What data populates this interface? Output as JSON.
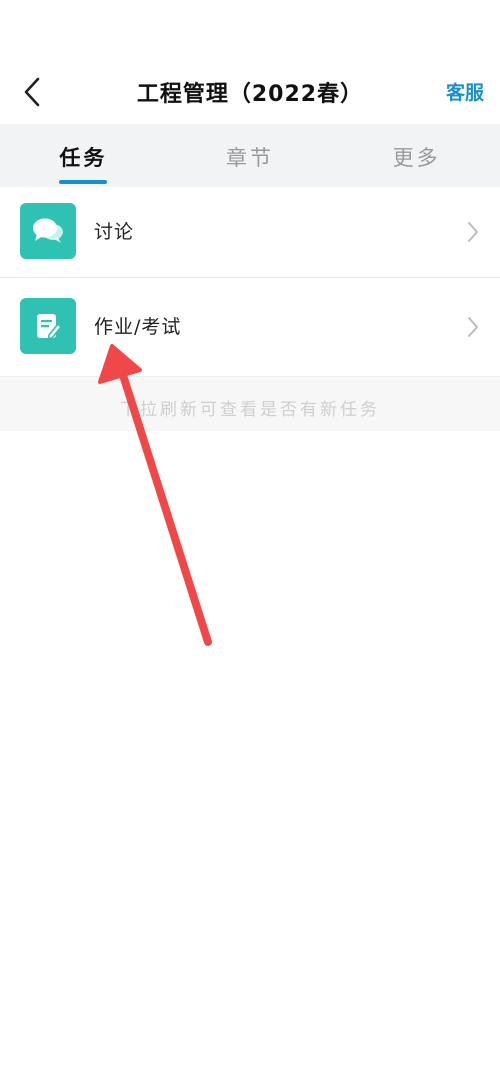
{
  "header": {
    "title": "工程管理（2022春）",
    "service_label": "客服",
    "back_icon": "chevron-left-icon"
  },
  "tabs": [
    {
      "label": "任务",
      "active": true
    },
    {
      "label": "章节",
      "active": false
    },
    {
      "label": "更多",
      "active": false
    }
  ],
  "list": {
    "items": [
      {
        "label": "讨论",
        "icon": "discussion-bubble-icon"
      },
      {
        "label": "作业/考试",
        "icon": "homework-edit-icon"
      }
    ]
  },
  "hint": "下拉刷新可查看是否有新任务",
  "colors": {
    "accent": "#1a8fd0",
    "icon_bg": "#2fc1b2",
    "annotation": "#f04848"
  }
}
